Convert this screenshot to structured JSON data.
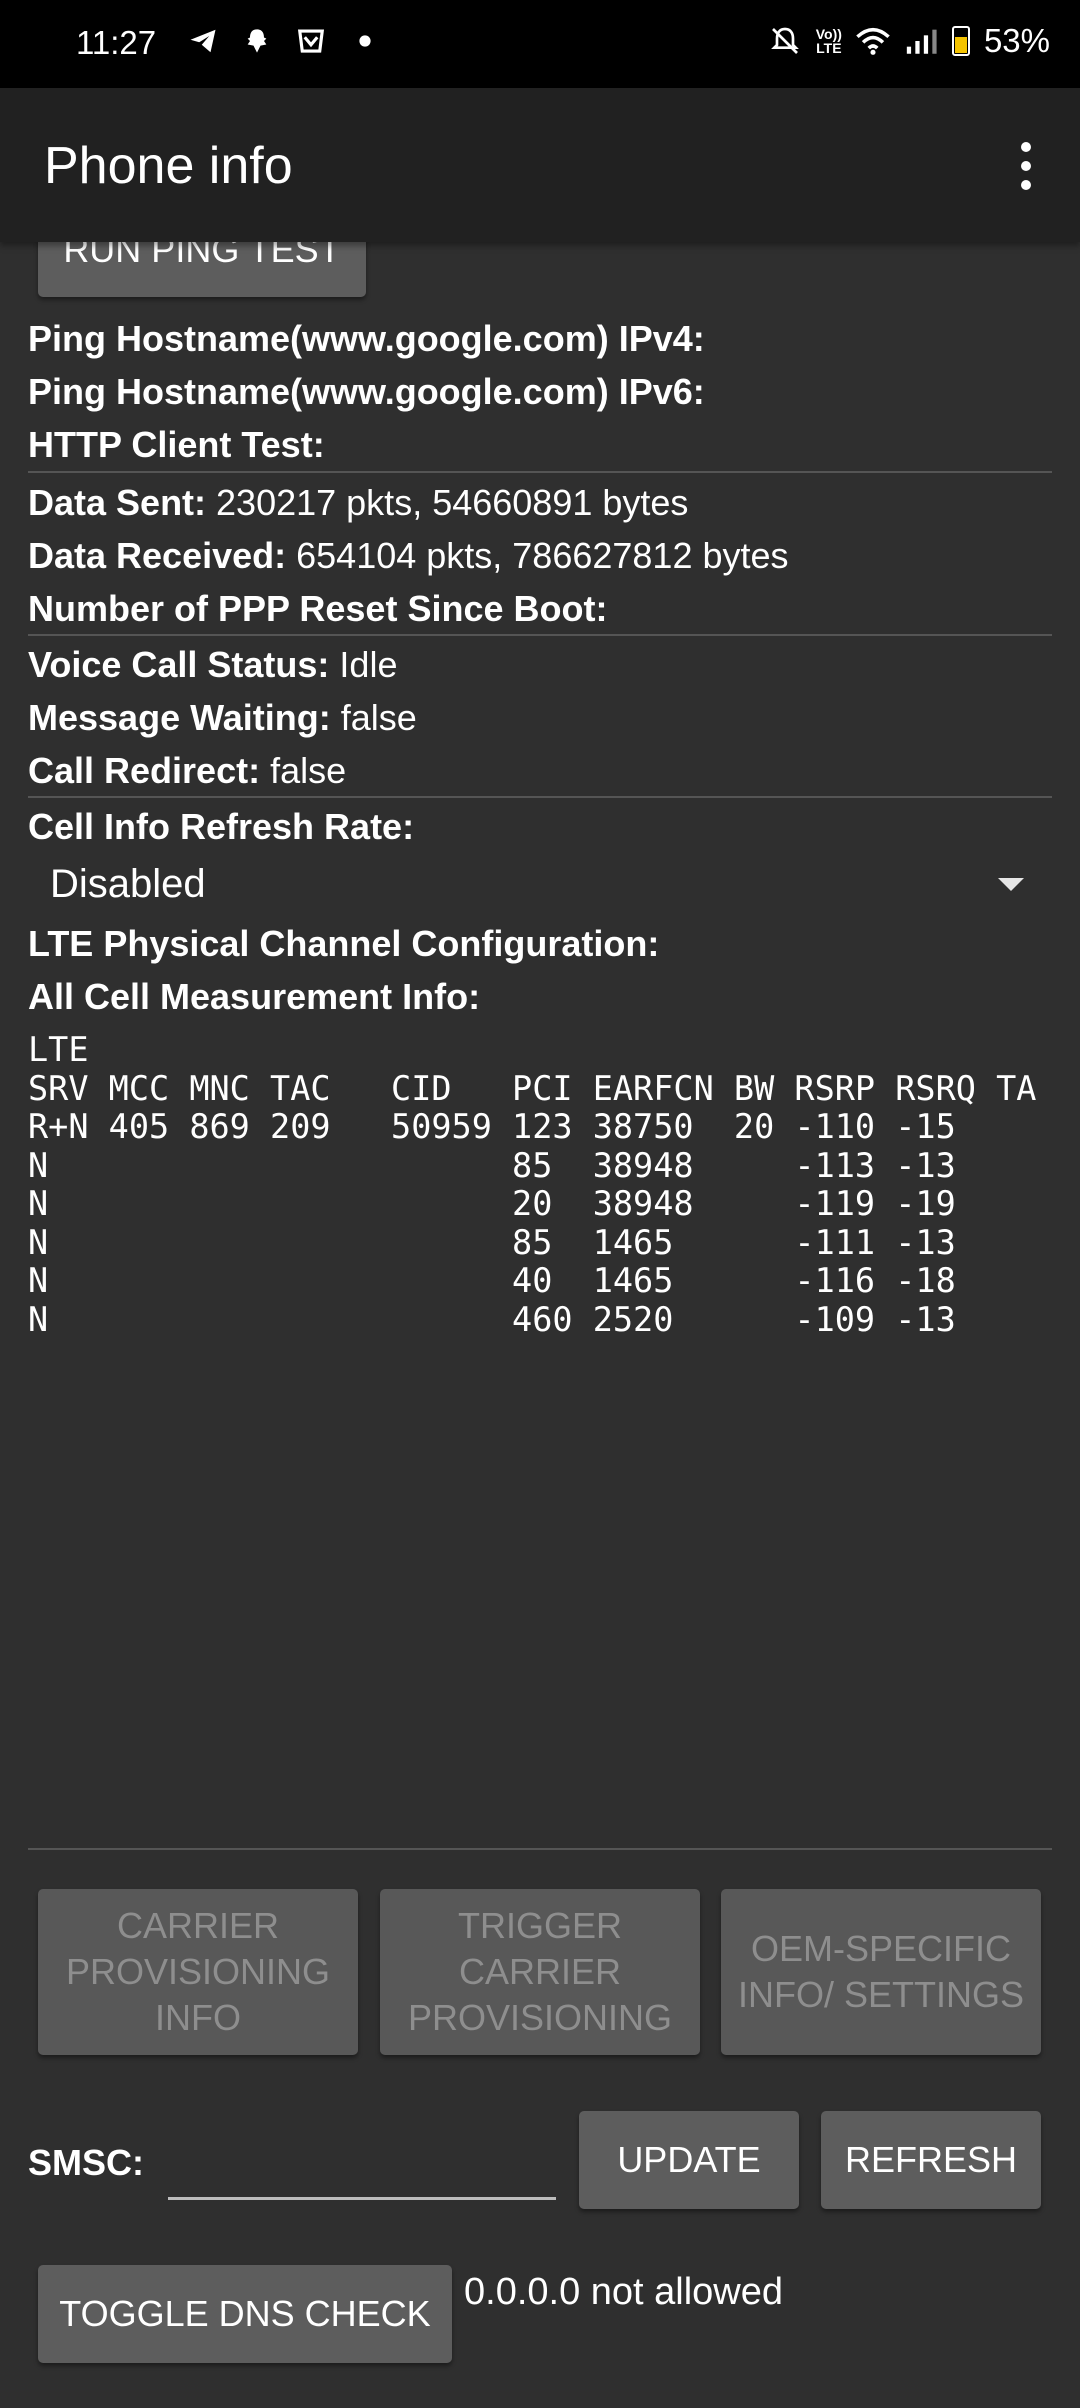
{
  "status_bar": {
    "time": "11:27",
    "battery": "53%",
    "volte_top": "Vo))",
    "volte_bottom": "LTE"
  },
  "app_bar": {
    "title": "Phone info"
  },
  "top_button": {
    "label": "RUN PING TEST"
  },
  "info_rows": {
    "ping_ipv4_label": "Ping Hostname(www.google.com) IPv4:",
    "ping_ipv6_label": "Ping Hostname(www.google.com) IPv6:",
    "http_label": "HTTP Client Test:",
    "data_sent_label": "Data Sent:",
    "data_sent_value": " 230217 pkts, 54660891 bytes",
    "data_received_label": "Data Received:",
    "data_received_value": " 654104 pkts, 786627812 bytes",
    "ppp_reset_label": "Number of PPP Reset Since Boot:",
    "voice_call_label": "Voice Call Status:",
    "voice_call_value": " Idle",
    "message_waiting_label": "Message Waiting:",
    "message_waiting_value": " false",
    "call_redirect_label": "Call Redirect:",
    "call_redirect_value": " false",
    "refresh_rate_label": "Cell Info Refresh Rate:",
    "refresh_rate_value": "Disabled",
    "lte_phys_label": "LTE Physical Channel Configuration:",
    "all_cell_label": "All Cell Measurement Info:"
  },
  "cell_table": {
    "text": "LTE\nSRV MCC MNC TAC   CID   PCI EARFCN BW RSRP RSRQ TA\nR+N 405 869 209   50959 123 38750  20 -110 -15\nN                       85  38948     -113 -13\nN                       20  38948     -119 -19\nN                       85  1465      -111 -13\nN                       40  1465      -116 -18\nN                       460 2520      -109 -13"
  },
  "provisioning_buttons": {
    "carrier_info": "CARRIER PROVISIONING INFO",
    "trigger": "TRIGGER CARRIER PROVISIONING",
    "oem": "OEM-SPECIFIC INFO/ SETTINGS"
  },
  "smsc": {
    "label": "SMSC:",
    "value": "",
    "update": "UPDATE",
    "refresh": "REFRESH"
  },
  "dns": {
    "toggle": "TOGGLE DNS CHECK",
    "status": "0.0.0.0 not allowed"
  }
}
